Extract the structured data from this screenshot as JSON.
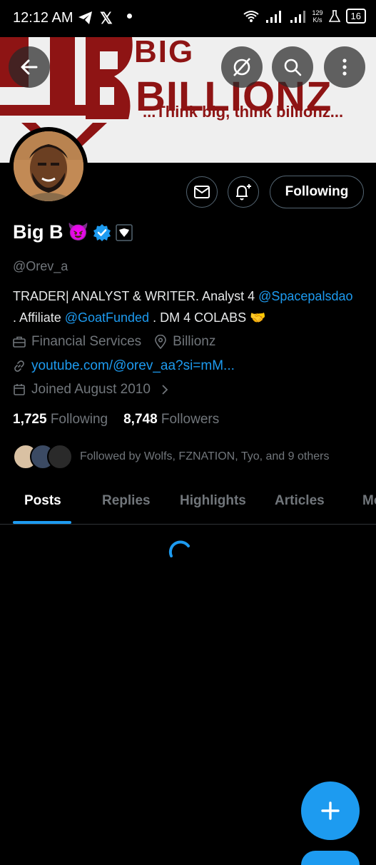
{
  "status_bar": {
    "time": "12:12 AM",
    "speed_value": "129",
    "speed_unit": "K/s",
    "battery": "16",
    "icons": [
      "telegram-icon",
      "x-icon",
      "notification-dot",
      "wifi-icon",
      "signal-icon",
      "signal-icon-2",
      "flask-icon",
      "battery-icon"
    ]
  },
  "banner": {
    "logo_text_top": "BIG",
    "logo_text_main": "BILLIONZ",
    "tagline": "...Think big, think billionz...",
    "colors": {
      "brand_red": "#8e1414",
      "background": "#efefef"
    }
  },
  "header_buttons": [
    "back-arrow-icon",
    "grok-icon",
    "search-icon",
    "more-vertical-icon"
  ],
  "profile": {
    "name": "Big B",
    "name_emoji": "😈",
    "handle": "@Orev_a",
    "bio_1": "TRADER| ANALYST & WRITER. Analyst 4 ",
    "bio_mention_1": "@Spacepalsdao",
    "bio_2": ". Affiliate ",
    "bio_mention_2": "@GoatFunded",
    "bio_3": " . DM 4 COLABS ",
    "bio_emoji": "🤝",
    "category": "Financial Services",
    "location": "Billionz",
    "website": "youtube.com/@orev_aa?si=mM...",
    "joined": "Joined August 2010",
    "following_count": "1,725",
    "following_label": "Following",
    "followers_count": "8,748",
    "followers_label": "Followers",
    "followed_by": "Followed by Wolfs, FZNATION, Tyo, and 9 others"
  },
  "actions": {
    "follow_button": "Following"
  },
  "tabs": [
    "Posts",
    "Replies",
    "Highlights",
    "Articles",
    "Me"
  ],
  "active_tab": "Posts",
  "colors": {
    "accent": "#1d9bf0",
    "muted_text": "#71767b",
    "background": "#000000"
  }
}
